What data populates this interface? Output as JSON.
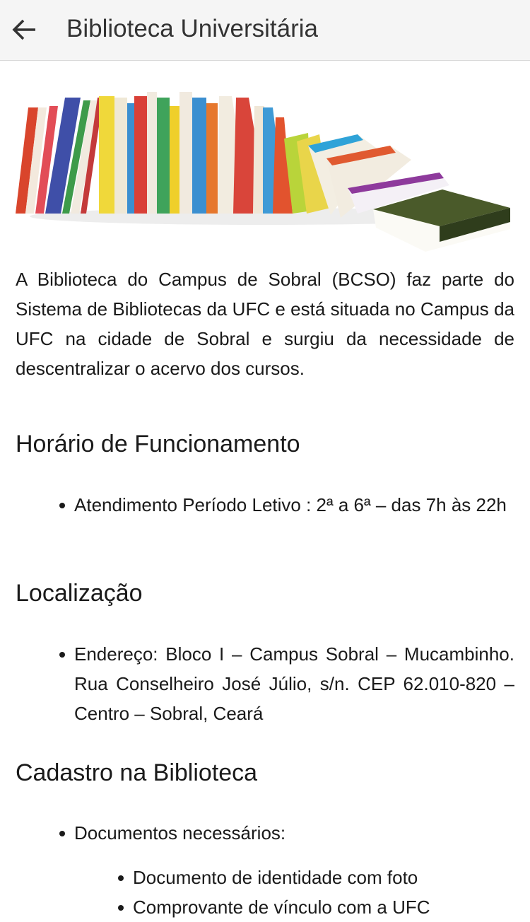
{
  "appbar": {
    "title": "Biblioteca Universitária",
    "back_icon": "arrow-left-icon"
  },
  "hero": {
    "image": "stack-of-books-illustration"
  },
  "intro": {
    "text": "A Biblioteca do Campus de Sobral (BCSO) faz parte do Sistema de Bibliotecas da UFC e está situada no Campus da UFC na cidade de Sobral e surgiu da necessidade de descentralizar o acervo dos cursos."
  },
  "sections": {
    "hours": {
      "title": "Horário de Funcionamento",
      "items": [
        "Atendimento Período Letivo : 2ª a 6ª – das 7h às 22h"
      ]
    },
    "location": {
      "title": "Localização",
      "items": [
        "Endereço: Bloco I – Campus Sobral – Mucambinho. Rua Conselheiro José Júlio, s/n. CEP 62.010-820 – Centro – Sobral, Ceará"
      ]
    },
    "registration": {
      "title": "Cadastro na Biblioteca",
      "items": [
        "Documentos necessários:"
      ],
      "subitems": [
        "Documento de identidade com foto",
        "Comprovante de vínculo com a UFC"
      ]
    }
  }
}
